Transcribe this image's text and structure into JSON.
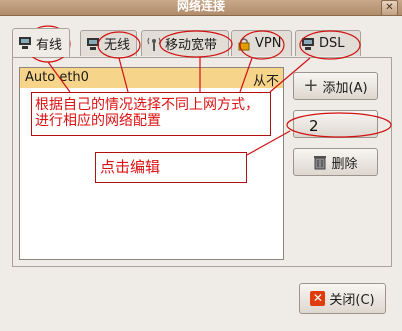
{
  "window": {
    "title": "网络连接",
    "close_glyph": "✕"
  },
  "tabs": [
    {
      "label": "有线",
      "icon": "wired-network-icon"
    },
    {
      "label": "无线",
      "icon": "wireless-network-icon"
    },
    {
      "label": "移动宽带",
      "icon": "mobile-broadband-icon"
    },
    {
      "label": "VPN",
      "icon": "lock-icon"
    },
    {
      "label": "DSL",
      "icon": "dsl-modem-icon"
    }
  ],
  "connections": [
    {
      "name": "Auto eth0",
      "last_used": "从不"
    }
  ],
  "buttons": {
    "add": "添加(A)",
    "edit": "",
    "delete": "删除",
    "close": "关闭(C)"
  },
  "annotations": {
    "tabs_note": "根据自己的情况选择不同上网方式，进行相应的网络配置",
    "edit_number": "2",
    "edit_note": "点击编辑"
  },
  "colors": {
    "annotation_red": "#d11111",
    "selection": "#f6d48a",
    "titlebar": "#b08c6b"
  }
}
